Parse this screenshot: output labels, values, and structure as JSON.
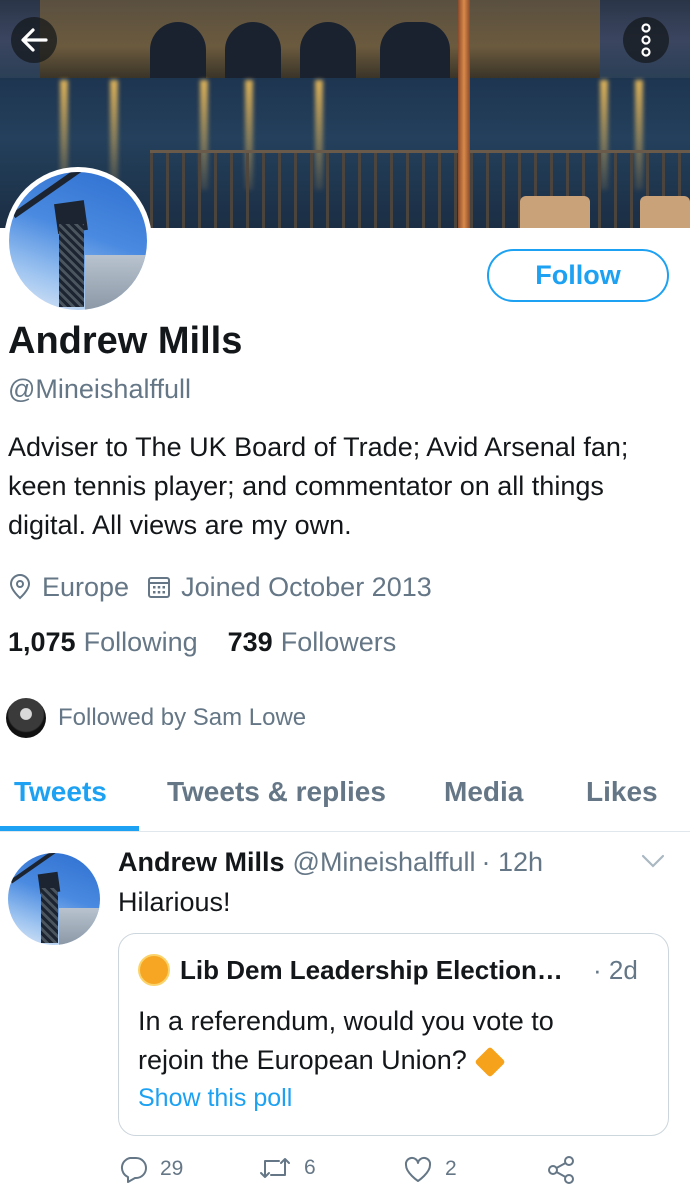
{
  "header": {
    "back_icon": "arrow-left-icon",
    "more_icon": "more-vertical-icon"
  },
  "profile": {
    "name": "Andrew Mills",
    "handle": "@Mineishalffull",
    "bio": "Adviser to The UK Board of Trade; Avid Arsenal fan; keen tennis player; and commentator on all things digital. All views are my own.",
    "location": "Europe",
    "joined": "Joined October 2013",
    "following_count": "1,075",
    "following_label": "Following",
    "followers_count": "739",
    "followers_label": "Followers",
    "followed_by": "Followed by Sam Lowe",
    "follow_button": "Follow"
  },
  "tabs": [
    {
      "label": "Tweets",
      "active": true
    },
    {
      "label": "Tweets & replies",
      "active": false
    },
    {
      "label": "Media",
      "active": false
    },
    {
      "label": "Likes",
      "active": false
    }
  ],
  "tweet": {
    "author": "Andrew Mills",
    "handle": "@Mineishalffull",
    "time": "· 12h",
    "text": "Hilarious!",
    "quote": {
      "author": "Lib Dem Leadership Election…",
      "time": "· 2d",
      "text": "In a referendum, would you vote to rejoin the European Union?",
      "link": "Show this poll"
    },
    "replies": "29",
    "retweets": "6",
    "likes": "2"
  },
  "colors": {
    "accent": "#1da1f2",
    "secondary_text": "#657786",
    "primary_text": "#14171a"
  }
}
